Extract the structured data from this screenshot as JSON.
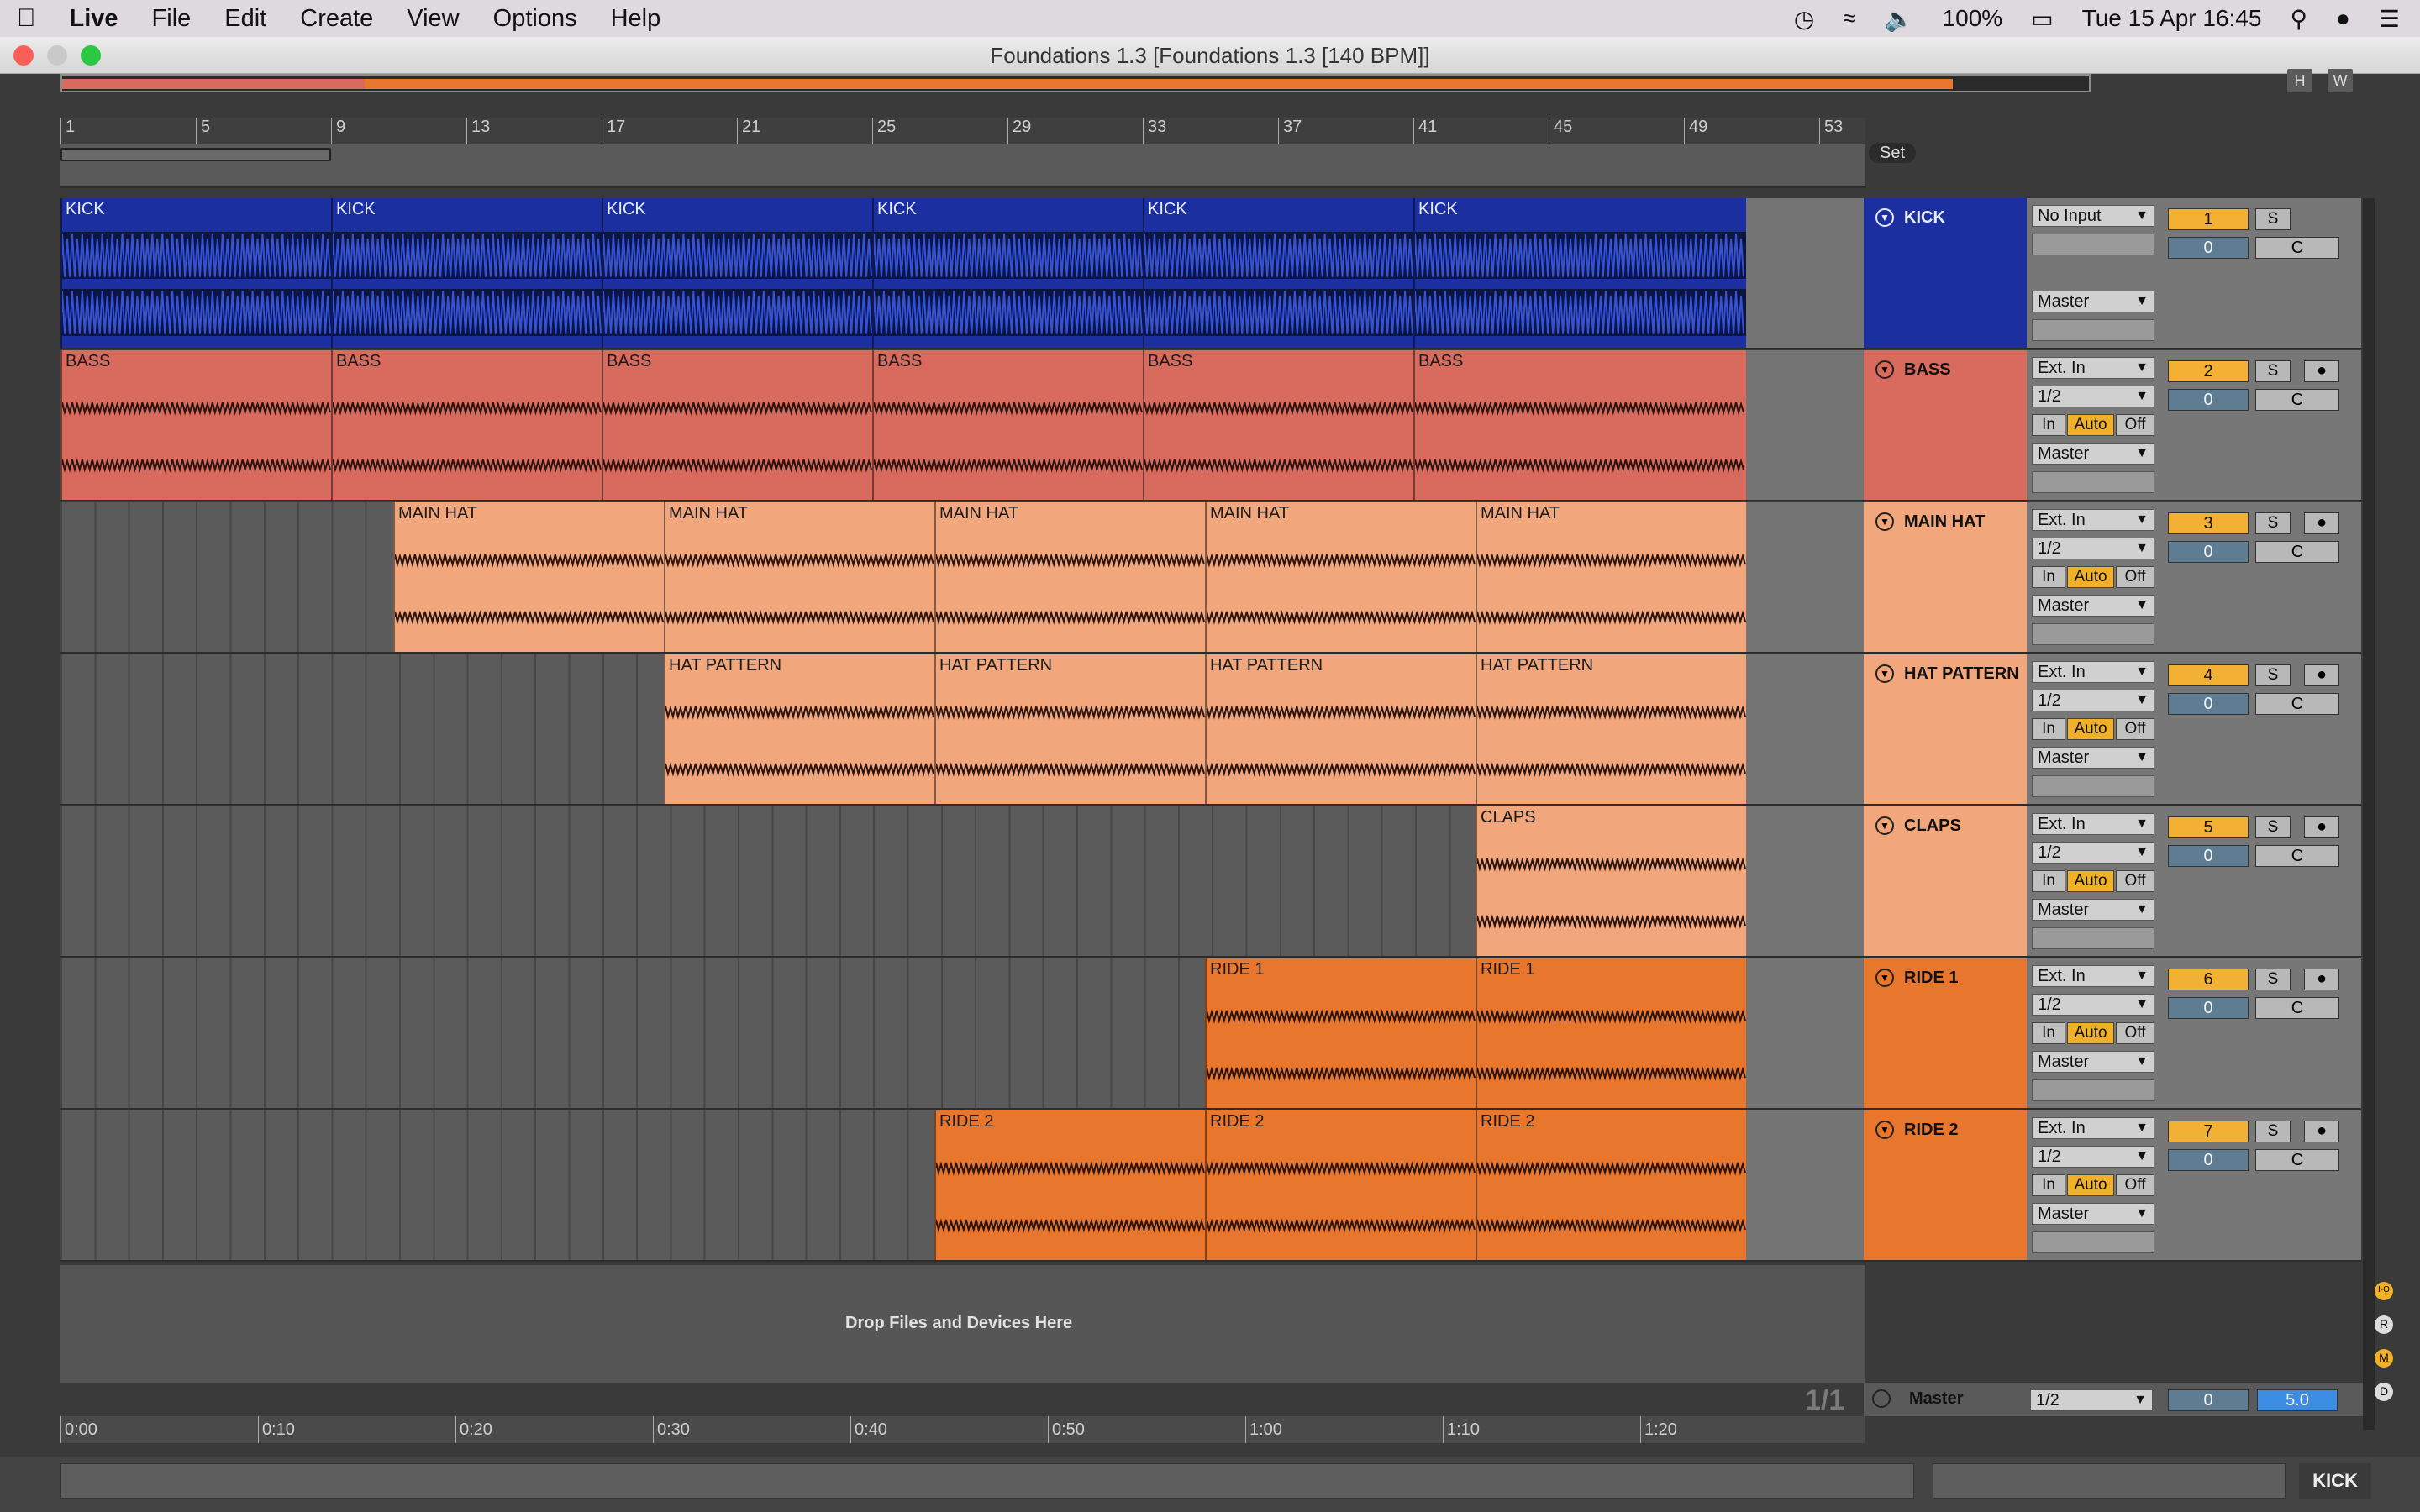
{
  "menubar": {
    "apple_icon": "apple-icon",
    "app": "Live",
    "items": [
      "File",
      "Edit",
      "Create",
      "View",
      "Options",
      "Help"
    ],
    "battery": "100%",
    "datetime": "Tue 15 Apr  16:45"
  },
  "window": {
    "title": "Foundations 1.3  [Foundations 1.3 [140 BPM]]",
    "hw_buttons": [
      "H",
      "W"
    ]
  },
  "ruler": {
    "bars": [
      "1",
      "5",
      "9",
      "13",
      "17",
      "21",
      "25",
      "29",
      "33",
      "37",
      "41",
      "45",
      "49",
      "53"
    ],
    "set_label": "Set"
  },
  "tracks": [
    {
      "name": "KICK",
      "color": "#1b2fa0",
      "clips": [
        "KICK",
        "KICK",
        "KICK",
        "KICK",
        "KICK",
        "KICK"
      ],
      "input": "No Input",
      "channel": "",
      "monitor": false,
      "output": "Master",
      "number": "1",
      "volume": "0",
      "pan": "C"
    },
    {
      "name": "BASS",
      "color": "#d86a5e",
      "clips": [
        "BASS",
        "BASS",
        "BASS",
        "BASS",
        "BASS",
        "BASS"
      ],
      "input": "Ext. In",
      "channel": "1/2",
      "monitor": true,
      "output": "Master",
      "number": "2",
      "volume": "0",
      "pan": "C"
    },
    {
      "name": "MAIN HAT",
      "color": "#f2a67b",
      "clips": [
        "MAIN HAT",
        "MAIN HAT",
        "MAIN HAT",
        "MAIN HAT",
        "MAIN HAT"
      ],
      "input": "Ext. In",
      "channel": "1/2",
      "monitor": true,
      "output": "Master",
      "number": "3",
      "volume": "0",
      "pan": "C"
    },
    {
      "name": "HAT PATTERN",
      "color": "#f2a67b",
      "clips": [
        "HAT PATTERN",
        "HAT PATTERN",
        "HAT PATTERN",
        "HAT PATTERN"
      ],
      "input": "Ext. In",
      "channel": "1/2",
      "monitor": true,
      "output": "Master",
      "number": "4",
      "volume": "0",
      "pan": "C"
    },
    {
      "name": "CLAPS",
      "color": "#f2a67b",
      "clips": [
        "CLAPS"
      ],
      "input": "Ext. In",
      "channel": "1/2",
      "monitor": true,
      "output": "Master",
      "number": "5",
      "volume": "0",
      "pan": "C"
    },
    {
      "name": "RIDE 1",
      "color": "#e9762d",
      "clips": [
        "RIDE 1",
        "RIDE 1"
      ],
      "input": "Ext. In",
      "channel": "1/2",
      "monitor": true,
      "output": "Master",
      "number": "6",
      "volume": "0",
      "pan": "C"
    },
    {
      "name": "RIDE 2",
      "color": "#e9762d",
      "clips": [
        "RIDE 2",
        "RIDE 2",
        "RIDE 2"
      ],
      "input": "Ext. In",
      "channel": "1/2",
      "monitor": true,
      "output": "Master",
      "number": "7",
      "volume": "0",
      "pan": "C"
    }
  ],
  "monitor_labels": {
    "in": "In",
    "auto": "Auto",
    "off": "Off"
  },
  "solo_label": "S",
  "drop_text": "Drop Files and Devices Here",
  "master": {
    "name": "Master",
    "channel": "1/2",
    "volume": "0",
    "cue": "5.0",
    "page": "1/1"
  },
  "time_ruler": [
    "0:00",
    "0:10",
    "0:20",
    "0:30",
    "0:40",
    "0:50",
    "1:00",
    "1:10",
    "1:20"
  ],
  "side_buttons": [
    "I-O",
    "R",
    "M",
    "D"
  ],
  "status": {
    "selected_track": "KICK"
  }
}
